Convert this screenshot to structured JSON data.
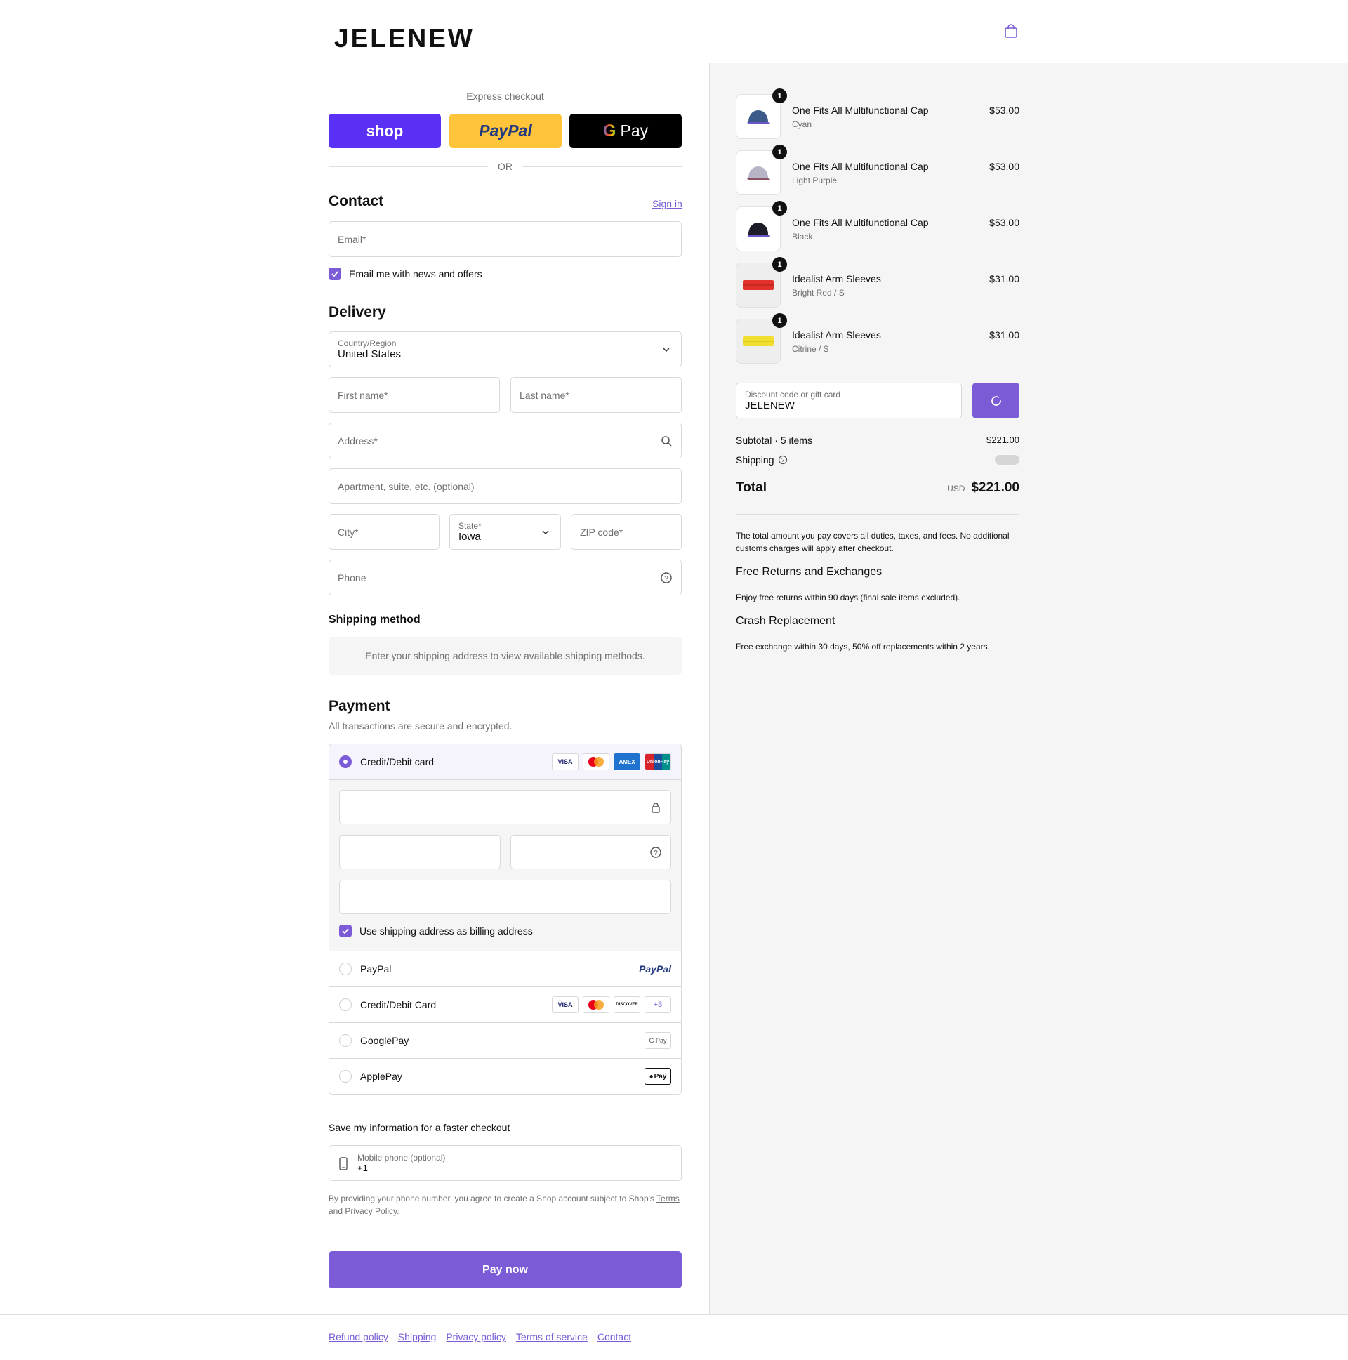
{
  "header": {
    "logo": "JELENEW",
    "cart_icon": "shopping-bag-icon"
  },
  "express": {
    "label": "Express checkout",
    "shop": "shop",
    "paypal": "PayPal",
    "gpay": "Pay",
    "or": "OR"
  },
  "contact": {
    "title": "Contact",
    "sign_in": "Sign in",
    "email_placeholder": "Email*",
    "news_label": "Email me with news and offers"
  },
  "delivery": {
    "title": "Delivery",
    "country_label": "Country/Region",
    "country_value": "United States",
    "first_name": "First name*",
    "last_name": "Last name*",
    "address": "Address*",
    "apartment": "Apartment, suite, etc. (optional)",
    "city": "City*",
    "state_label": "State*",
    "state_value": "Iowa",
    "zip": "ZIP code*",
    "phone": "Phone"
  },
  "shipping_method": {
    "title": "Shipping method",
    "message": "Enter your shipping address to view available shipping methods."
  },
  "payment": {
    "title": "Payment",
    "subtitle": "All transactions are secure and encrypted.",
    "options": [
      {
        "label": "Credit/Debit card",
        "selected": true
      },
      {
        "label": "PayPal",
        "selected": false
      },
      {
        "label": "Credit/Debit Card",
        "selected": false
      },
      {
        "label": "GooglePay",
        "selected": false
      },
      {
        "label": "ApplePay",
        "selected": false
      }
    ],
    "card_logos": [
      "VISA",
      "MC",
      "AMEX",
      "UnionPay"
    ],
    "card_logos_2": [
      "VISA",
      "MC",
      "DISCOVER",
      "+3"
    ],
    "paypal_logo": "PayPal",
    "gpay_logo": "G Pay",
    "applepay_logo": "Pay",
    "billing_same": "Use shipping address as billing address"
  },
  "save_info": {
    "title": "Save my information for a faster checkout",
    "phone_label": "Mobile phone (optional)",
    "phone_value": "+1",
    "legal_pre": "By providing your phone number, you agree to create a Shop account subject to Shop's",
    "terms": "Terms",
    "and": "and",
    "privacy": "Privacy Policy",
    "dot": "."
  },
  "pay_now": "Pay now",
  "footer": {
    "links": [
      "Refund policy",
      "Shipping",
      "Privacy policy",
      "Terms of service",
      "Contact"
    ]
  },
  "order": {
    "items": [
      {
        "name": "One Fits All Multifunctional Cap",
        "variant": "Cyan",
        "price": "$53.00",
        "qty": "1",
        "color": "#3b5a8a"
      },
      {
        "name": "One Fits All Multifunctional Cap",
        "variant": "Light Purple",
        "price": "$53.00",
        "qty": "1",
        "color": "#b8b4c8"
      },
      {
        "name": "One Fits All Multifunctional Cap",
        "variant": "Black",
        "price": "$53.00",
        "qty": "1",
        "color": "#1d1d2a"
      },
      {
        "name": "Idealist Arm Sleeves",
        "variant": "Bright Red / S",
        "price": "$31.00",
        "qty": "1",
        "color": "#e0322a"
      },
      {
        "name": "Idealist Arm Sleeves",
        "variant": "Citrine / S",
        "price": "$31.00",
        "qty": "1",
        "color": "#f2de2e"
      }
    ],
    "discount_label": "Discount code or gift card",
    "discount_value": "JELENEW",
    "subtotal_label": "Subtotal · 5 items",
    "subtotal_value": "$221.00",
    "shipping_label": "Shipping",
    "total_label": "Total",
    "currency": "USD",
    "total_value": "$221.00",
    "note": "The total amount you pay covers all duties, taxes, and fees. No additional customs charges will apply after checkout.",
    "returns_title": "Free Returns and Exchanges",
    "returns_text": "Enjoy free returns within 90 days (final sale items excluded).",
    "crash_title": "Crash Replacement",
    "crash_text": "Free exchange within 30 days, 50% off replacements within 2 years."
  },
  "colors": {
    "accent": "#7b5cd6",
    "shop": "#5a31f4",
    "paypal": "#ffc439"
  }
}
